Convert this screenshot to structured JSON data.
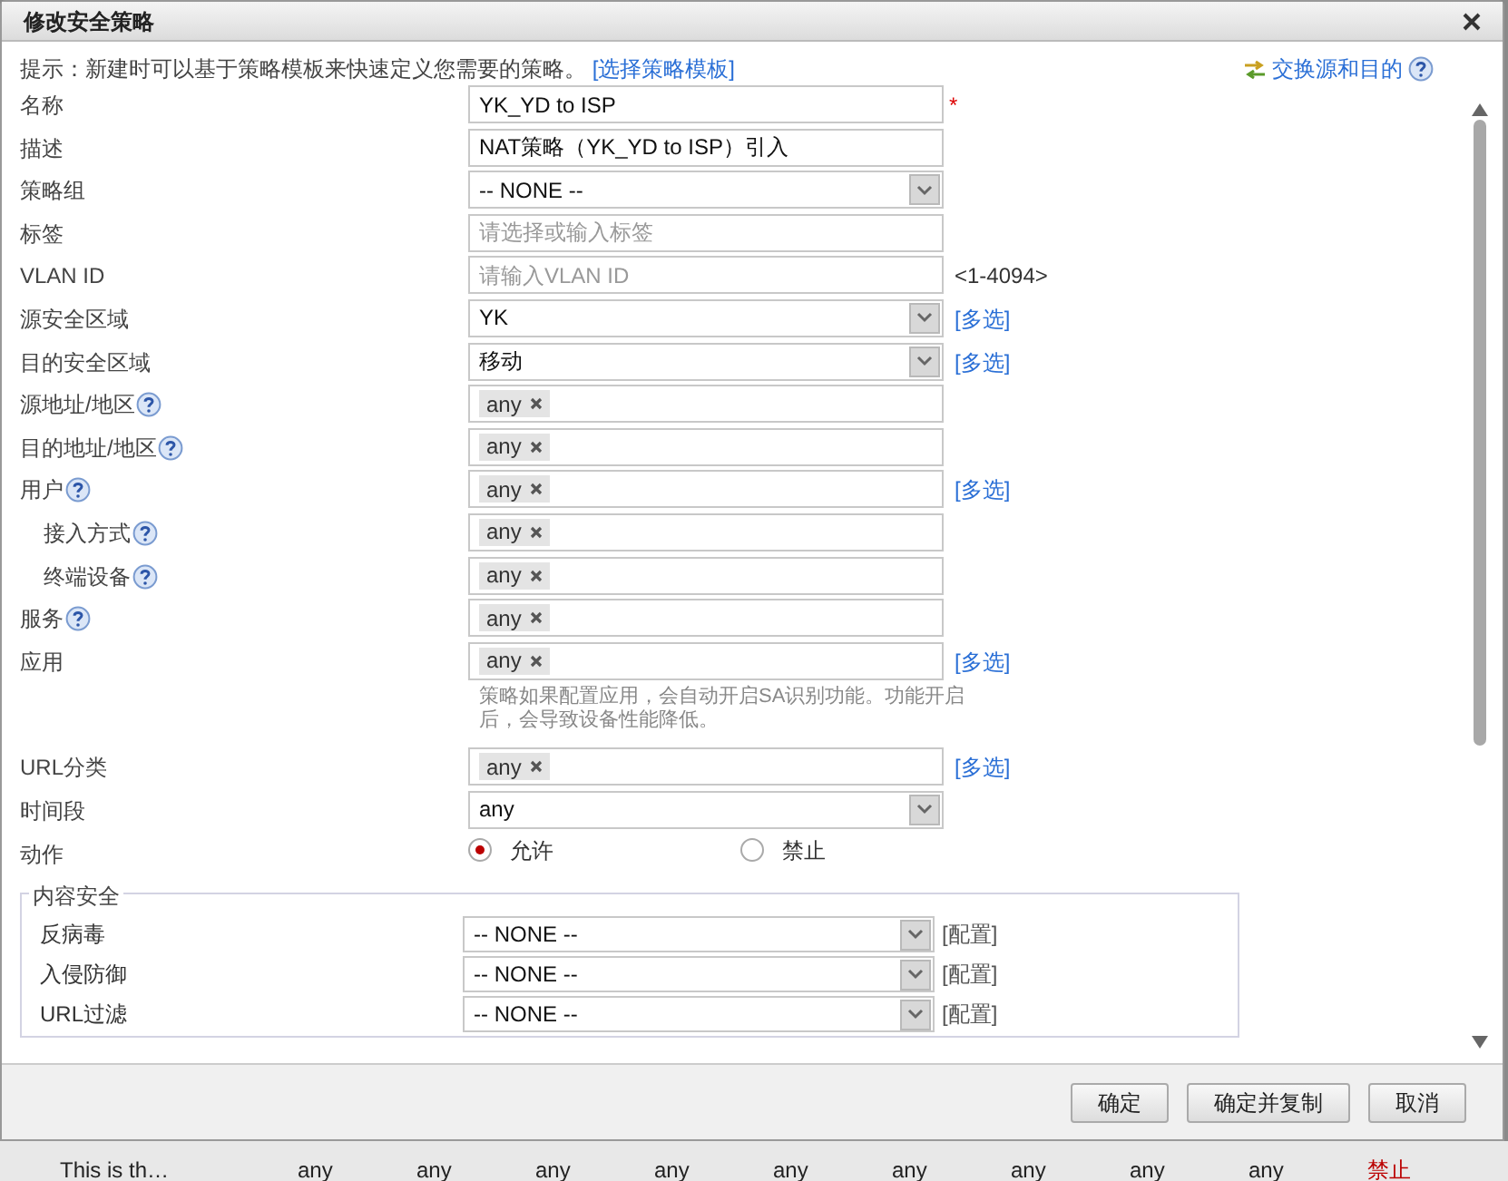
{
  "dialog": {
    "title": "修改安全策略"
  },
  "hint": {
    "text": "提示：新建时可以基于策略模板来快速定义您需要的策略。",
    "link": "[选择策略模板]"
  },
  "swap_link": "交换源和目的",
  "fields": [
    {
      "kind": "text",
      "label": "名称",
      "value": "YK_YD to ISP",
      "suffix": {
        "kind": "required",
        "text": "*"
      }
    },
    {
      "kind": "text",
      "label": "描述",
      "value": "NAT策略（YK_YD to ISP）引入"
    },
    {
      "kind": "select",
      "label": "策略组",
      "value": "-- NONE --"
    },
    {
      "kind": "text",
      "label": "标签",
      "placeholder": "请选择或输入标签"
    },
    {
      "kind": "text",
      "label": "VLAN ID",
      "placeholder": "请输入VLAN ID",
      "suffix": {
        "kind": "plain",
        "text": "<1-4094>"
      }
    },
    {
      "kind": "select",
      "label": "源安全区域",
      "value": "YK",
      "suffix": {
        "kind": "link",
        "text": "[多选]"
      }
    },
    {
      "kind": "select",
      "label": "目的安全区域",
      "value": "移动",
      "suffix": {
        "kind": "link",
        "text": "[多选]"
      }
    },
    {
      "kind": "tags",
      "label": "源地址/地区",
      "help": true,
      "tags": [
        "any"
      ]
    },
    {
      "kind": "tags",
      "label": "目的地址/地区",
      "help": true,
      "tags": [
        "any"
      ]
    },
    {
      "kind": "tags",
      "label": "用户",
      "help": true,
      "tags": [
        "any"
      ],
      "suffix": {
        "kind": "link",
        "text": "[多选]"
      },
      "children": [
        {
          "kind": "tags",
          "label": "接入方式",
          "help": true,
          "tags": [
            "any"
          ]
        },
        {
          "kind": "tags",
          "label": "终端设备",
          "help": true,
          "tags": [
            "any"
          ]
        }
      ]
    },
    {
      "kind": "tags",
      "label": "服务",
      "help": true,
      "tags": [
        "any"
      ]
    },
    {
      "kind": "tags",
      "label": "应用",
      "tags": [
        "any"
      ],
      "suffix": {
        "kind": "link",
        "text": "[多选]"
      }
    },
    {
      "kind": "note",
      "text": "策略如果配置应用，会自动开启SA识别功能。功能开启后，会导致设备性能降低。"
    },
    {
      "kind": "tags",
      "label": "URL分类",
      "tags": [
        "any"
      ],
      "suffix": {
        "kind": "link",
        "text": "[多选]"
      }
    },
    {
      "kind": "select",
      "label": "时间段",
      "value": "any"
    },
    {
      "kind": "radio",
      "label": "动作",
      "options": [
        {
          "label": "允许",
          "selected": true
        },
        {
          "label": "禁止",
          "selected": false
        }
      ]
    }
  ],
  "content_security": {
    "legend": "内容安全",
    "fields": [
      {
        "label": "反病毒",
        "value": "-- NONE --",
        "suffix": "[配置]"
      },
      {
        "label": "入侵防御",
        "value": "-- NONE --",
        "suffix": "[配置]"
      },
      {
        "label": "URL过滤",
        "value": "-- NONE --",
        "suffix": "[配置]"
      }
    ]
  },
  "buttons": [
    "确定",
    "确定并复制",
    "取消"
  ],
  "background_row": [
    "This is th…",
    "any",
    "any",
    "any",
    "any",
    "any",
    "any",
    "any",
    "any",
    "any",
    "禁止"
  ]
}
